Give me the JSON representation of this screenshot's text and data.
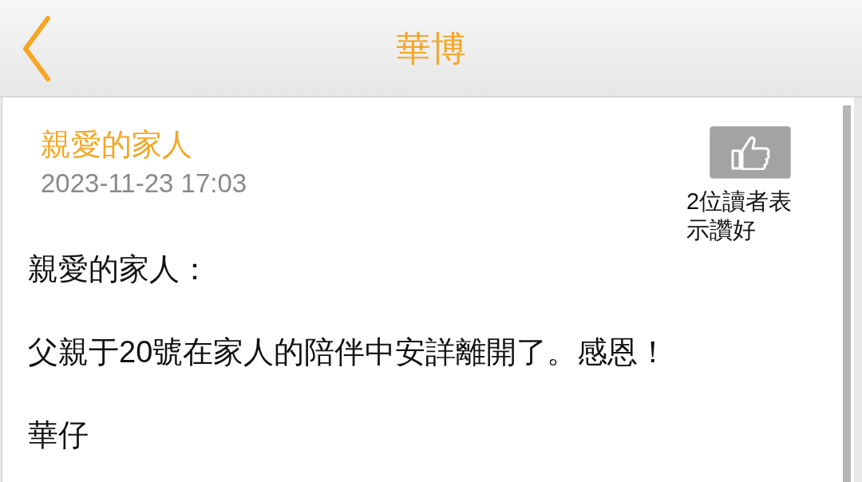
{
  "header": {
    "title": "華博"
  },
  "post": {
    "title": "親愛的家人",
    "date": "2023-11-23 17:03",
    "likes": "2位讀者表示讚好",
    "paragraphs": [
      "親愛的家人：",
      "父親于20號在家人的陪伴中安詳離開了。感恩！",
      "華仔"
    ]
  }
}
